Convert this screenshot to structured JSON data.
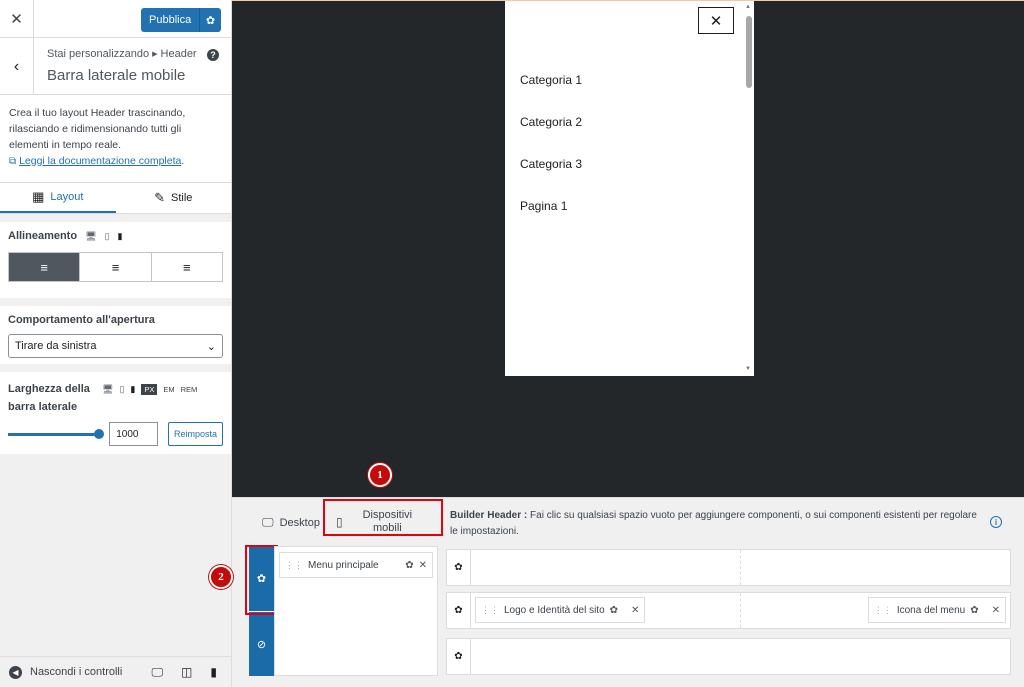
{
  "sidebar": {
    "close": "✕",
    "publish": "Pubblica",
    "breadcrumb_prefix": "Stai personalizzando",
    "breadcrumb_section": "Header",
    "title": "Barra laterale mobile",
    "description": "Crea il tuo layout Header trascinando, rilasciando e ridimensionando tutti gli elementi in tempo reale.",
    "doc_link": "Leggi la documentazione completa",
    "tabs": [
      {
        "label": "Layout",
        "active": true
      },
      {
        "label": "Stile",
        "active": false
      }
    ],
    "alignment": {
      "label": "Allineamento",
      "selected": "left"
    },
    "behaviour": {
      "label": "Comportamento all'apertura",
      "value": "Tirare da sinistra"
    },
    "width": {
      "label_line1": "Larghezza della",
      "label_line2": "barra laterale",
      "units": [
        "PX",
        "EM",
        "REM"
      ],
      "selected_unit": "PX",
      "value": "1000",
      "reset": "Reimposta"
    },
    "footer": {
      "hide_controls": "Nascondi i controlli",
      "active_device": "mobile"
    }
  },
  "preview": {
    "close": "✕",
    "menu_items": [
      "Categoria 1",
      "Categoria 2",
      "Categoria 3",
      "Pagina 1"
    ]
  },
  "builder": {
    "tab_desktop": "Desktop",
    "tab_mobile_line1": "Dispositivi",
    "tab_mobile_line2": "mobili",
    "info_bold": "Builder Header :",
    "info_text": "Fai clic su qualsiasi spazio vuoto per aggiungere componenti, o sui componenti esistenti per regolare le impostazioni.",
    "offcanvas_item": "Menu principale",
    "logo_item": "Logo e Identità del sito",
    "menu_icon_item": "Icona del menu",
    "annotations": [
      "1",
      "2"
    ]
  },
  "colors": {
    "accent": "#2271b1",
    "highlight": "#e3000f",
    "preview_bg": "#23272a"
  }
}
